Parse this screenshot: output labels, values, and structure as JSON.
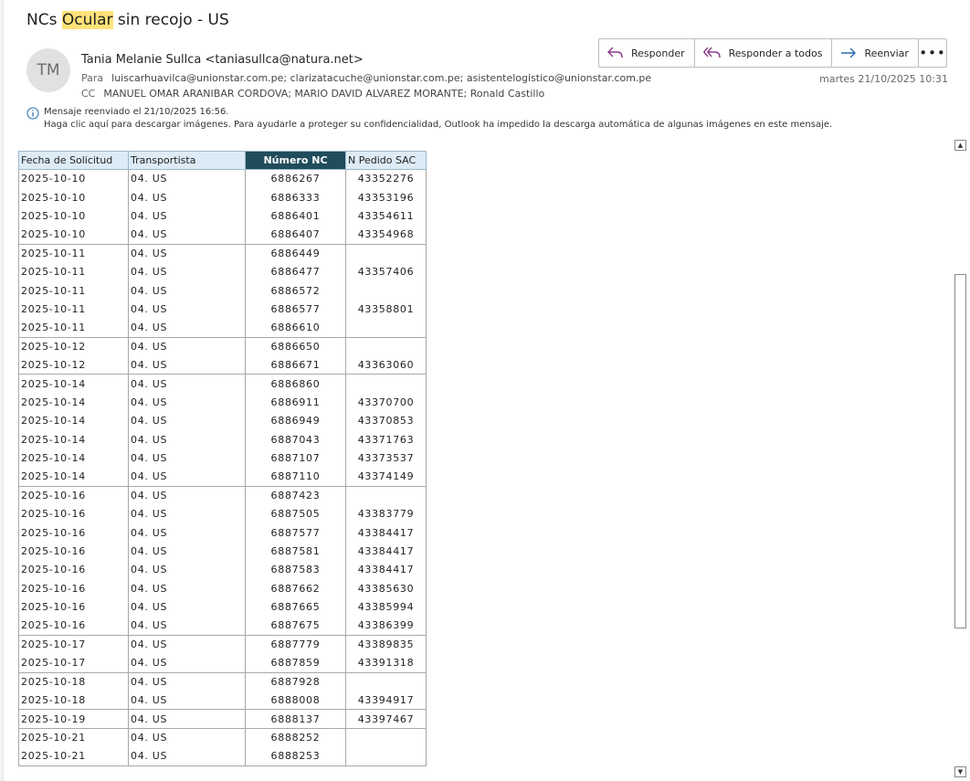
{
  "email": {
    "subject_pre": "NCs ",
    "subject_highlight": "Ocular",
    "subject_post": " sin recojo - US",
    "avatar_initials": "TM",
    "sender": "Tania Melanie Sullca <taniasullca@natura.net>",
    "to_label": "Para",
    "to": "luiscarhuavilca@unionstar.com.pe; clarizatacuche@unionstar.com.pe; asistentelogistico@unionstar.com.pe",
    "cc_label": "CC",
    "cc": "MANUEL OMAR ARANIBAR CORDOVA; MARIO DAVID ALVAREZ MORANTE; Ronald Castillo",
    "date": "martes 21/10/2025 10:31",
    "info_line1": "Mensaje reenviado el 21/10/2025 16:56.",
    "info_line2": "Haga clic aquí para descargar imágenes. Para ayudarle a proteger su confidencialidad, Outlook ha impedido la descarga automática de algunas imágenes en este mensaje."
  },
  "actions": {
    "reply": "Responder",
    "reply_all": "Responder a todos",
    "forward": "Reenviar",
    "more": "•••"
  },
  "colors": {
    "highlight": "#ffe27a",
    "header_light": "#dcebf5",
    "header_dark": "#204c5c",
    "icon_purple": "#8a3a8c",
    "icon_blue": "#2b6fb0"
  },
  "icons": {
    "reply": "reply-arrow-icon",
    "reply_all": "reply-all-arrow-icon",
    "forward": "forward-arrow-icon",
    "info": "info-circle-icon"
  },
  "table": {
    "headers": [
      "Fecha de Solicitud",
      "Transportista",
      "Número NC",
      "N Pedido SAC"
    ],
    "rows": [
      [
        "2025-10-10",
        "04. US",
        "6886267",
        "43352276"
      ],
      [
        "2025-10-10",
        "04. US",
        "6886333",
        "43353196"
      ],
      [
        "2025-10-10",
        "04. US",
        "6886401",
        "43354611"
      ],
      [
        "2025-10-10",
        "04. US",
        "6886407",
        "43354968"
      ],
      [
        "2025-10-11",
        "04. US",
        "6886449",
        ""
      ],
      [
        "2025-10-11",
        "04. US",
        "6886477",
        "43357406"
      ],
      [
        "2025-10-11",
        "04. US",
        "6886572",
        ""
      ],
      [
        "2025-10-11",
        "04. US",
        "6886577",
        "43358801"
      ],
      [
        "2025-10-11",
        "04. US",
        "6886610",
        ""
      ],
      [
        "2025-10-12",
        "04. US",
        "6886650",
        ""
      ],
      [
        "2025-10-12",
        "04. US",
        "6886671",
        "43363060"
      ],
      [
        "2025-10-14",
        "04. US",
        "6886860",
        ""
      ],
      [
        "2025-10-14",
        "04. US",
        "6886911",
        "43370700"
      ],
      [
        "2025-10-14",
        "04. US",
        "6886949",
        "43370853"
      ],
      [
        "2025-10-14",
        "04. US",
        "6887043",
        "43371763"
      ],
      [
        "2025-10-14",
        "04. US",
        "6887107",
        "43373537"
      ],
      [
        "2025-10-14",
        "04. US",
        "6887110",
        "43374149"
      ],
      [
        "2025-10-16",
        "04. US",
        "6887423",
        ""
      ],
      [
        "2025-10-16",
        "04. US",
        "6887505",
        "43383779"
      ],
      [
        "2025-10-16",
        "04. US",
        "6887577",
        "43384417"
      ],
      [
        "2025-10-16",
        "04. US",
        "6887581",
        "43384417"
      ],
      [
        "2025-10-16",
        "04. US",
        "6887583",
        "43384417"
      ],
      [
        "2025-10-16",
        "04. US",
        "6887662",
        "43385630"
      ],
      [
        "2025-10-16",
        "04. US",
        "6887665",
        "43385994"
      ],
      [
        "2025-10-16",
        "04. US",
        "6887675",
        "43386399"
      ],
      [
        "2025-10-17",
        "04. US",
        "6887779",
        "43389835"
      ],
      [
        "2025-10-17",
        "04. US",
        "6887859",
        "43391318"
      ],
      [
        "2025-10-18",
        "04. US",
        "6887928",
        ""
      ],
      [
        "2025-10-18",
        "04. US",
        "6888008",
        "43394917"
      ],
      [
        "2025-10-19",
        "04. US",
        "6888137",
        "43397467"
      ],
      [
        "2025-10-21",
        "04. US",
        "6888252",
        ""
      ],
      [
        "2025-10-21",
        "04. US",
        "6888253",
        ""
      ]
    ]
  }
}
